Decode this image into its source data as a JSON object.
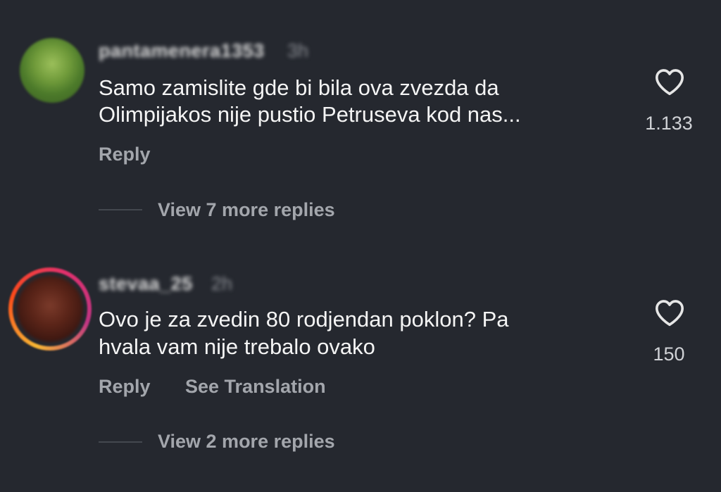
{
  "comments": [
    {
      "username": "pantamenera1353",
      "timestamp": "3h",
      "lines": [
        "Samo zamislite gde bi bila ova zvezda da",
        "Olimpijakos nije pustio Petruseva kod nas..."
      ],
      "reply_label": "Reply",
      "view_replies": "View 7 more replies",
      "likes": "1.133",
      "icon": "heart-icon"
    },
    {
      "username": "stevaa_25",
      "timestamp": "2h",
      "lines": [
        "Ovo je za zvedin 80 rodjendan poklon? Pa",
        "hvala vam nije trebalo ovako"
      ],
      "reply_label": "Reply",
      "translation_label": "See Translation",
      "view_replies": "View 2 more replies",
      "likes": "150",
      "icon": "heart-icon"
    }
  ],
  "colors": {
    "background": "#25282f",
    "text": "#f4f4f4",
    "secondary": "#a3a6ac"
  }
}
